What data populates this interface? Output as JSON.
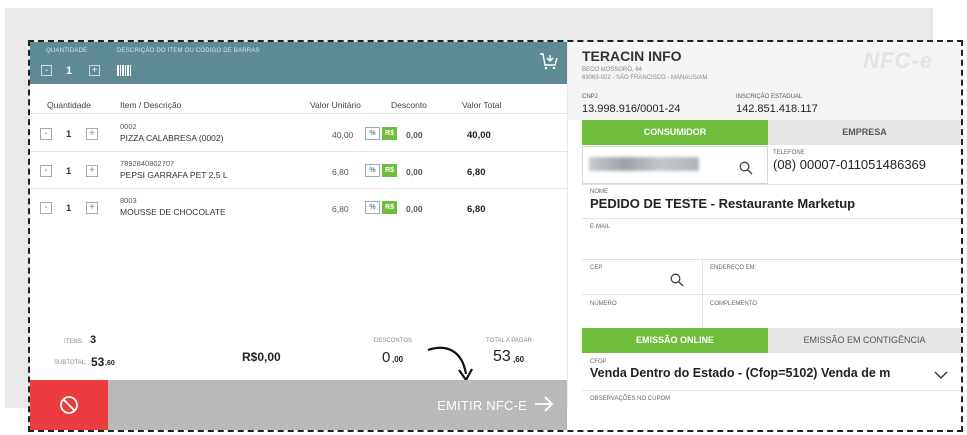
{
  "colors": {
    "teal": "#5e8a93",
    "green": "#6fbe3b",
    "red": "#ec3c3f",
    "grey_button": "#b9b9b9"
  },
  "pos": {
    "topbar": {
      "qty_label": "QUANTIDADE",
      "qty_value": "1",
      "desc_label": "DESCRIÇÃO DO ITEM OU CÓDIGO DE BARRAS",
      "cart_icon": "cart-icon",
      "barcode_icon": "barcode-icon"
    },
    "table": {
      "headers": [
        "Quantidade",
        "Item / Descrição",
        "Valor Unitário",
        "Desconto",
        "Valor Total"
      ],
      "rows": [
        {
          "qty": "1",
          "code": "0002",
          "desc": "PIZZA CALABRESA (0002)",
          "unit": "40,00",
          "pct": "%",
          "rs": "R$",
          "discount": "0,00",
          "total": "40,00"
        },
        {
          "qty": "1",
          "code": "7892840802707",
          "desc": "PEPSI GARRAFA PET 2,5 L",
          "unit": "6,80",
          "pct": "%",
          "rs": "R$",
          "discount": "0,00",
          "total": "6,80"
        },
        {
          "qty": "1",
          "code": "8003",
          "desc": "MOUSSE DE CHOCOLATE",
          "unit": "6,80",
          "pct": "%",
          "rs": "R$",
          "discount": "0,00",
          "total": "6,80"
        }
      ]
    },
    "summary": {
      "items_label": "ITENS:",
      "items_value": "3",
      "subtotal_label": "SUBTOTAL:",
      "subtotal_int": "53",
      "subtotal_dec": ",60",
      "money": "R$0,00",
      "discounts_label": "DESCONTOS",
      "discounts_int": "0",
      "discounts_dec": ",00",
      "total_label": "TOTAL A PAGAR",
      "total_int": "53",
      "total_dec": ",60"
    },
    "bottom": {
      "emit_label": "EMITIR NFC-E"
    }
  },
  "company": {
    "name": "TERACIN INFO",
    "addr1": "BECO MOSSORÓ, 64",
    "addr2": "69063-022 - SÃO FRANCISCO - MANAUS/AM",
    "logo": "NFC-e",
    "cnpj_label": "CNPJ",
    "cnpj": "13.998.916/0001-24",
    "ie_label": "INSCRIÇÃO ESTADUAL",
    "ie": "142.851.418.117"
  },
  "customer": {
    "tab_consumer": "CONSUMIDOR",
    "tab_company": "EMPRESA",
    "phone_label": "TELEFONE",
    "phone": "(08) 00007-011051486369",
    "name_label": "NOME",
    "name": "PEDIDO DE TESTE - Restaurante Marketup",
    "email_label": "E-MAIL",
    "cep_label": "CEP",
    "address_label": "ENDEREÇO EM:",
    "number_label": "NÚMERO",
    "complement_label": "COMPLEMENTO"
  },
  "emission": {
    "tab_online": "EMISSÃO ONLINE",
    "tab_contingency": "EMISSÃO EM CONTIGÊNCIA",
    "cfop_label": "CFOP",
    "cfop_value": "Venda Dentro do Estado - (Cfop=5102) Venda de m",
    "notes_label": "OBSERVAÇÕES NO CUPOM"
  }
}
